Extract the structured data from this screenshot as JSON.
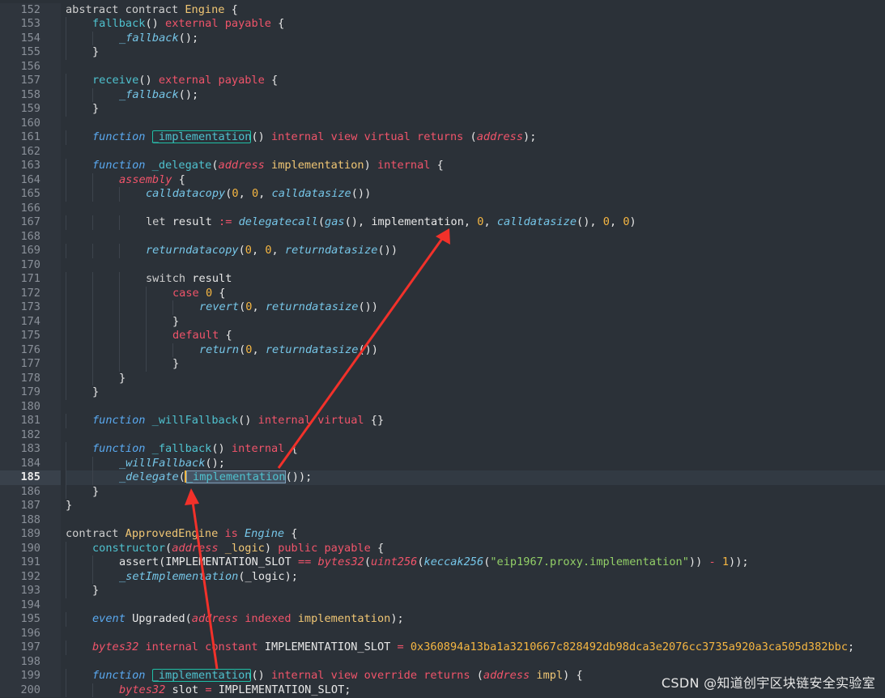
{
  "editor": {
    "current_line": 185,
    "lines": [
      {
        "n": "152",
        "indent": 0,
        "tokens": [
          [
            "abstract contract ",
            "kw"
          ],
          [
            "Engine",
            "ty"
          ],
          [
            " {",
            "pl"
          ]
        ]
      },
      {
        "n": "153",
        "indent": 1,
        "tokens": [
          [
            "fallback",
            "fn"
          ],
          [
            "() ",
            "pl"
          ],
          [
            "external payable",
            "mod"
          ],
          [
            " {",
            "pl"
          ]
        ]
      },
      {
        "n": "154",
        "indent": 2,
        "tokens": [
          [
            "_fallback",
            "iti"
          ],
          [
            "();",
            "pl"
          ]
        ]
      },
      {
        "n": "155",
        "indent": 1,
        "tokens": [
          [
            "}",
            "pl"
          ]
        ]
      },
      {
        "n": "156",
        "indent": 0,
        "tokens": []
      },
      {
        "n": "157",
        "indent": 1,
        "tokens": [
          [
            "receive",
            "fn"
          ],
          [
            "() ",
            "pl"
          ],
          [
            "external payable",
            "mod"
          ],
          [
            " {",
            "pl"
          ]
        ]
      },
      {
        "n": "158",
        "indent": 2,
        "tokens": [
          [
            "_fallback",
            "iti"
          ],
          [
            "();",
            "pl"
          ]
        ]
      },
      {
        "n": "159",
        "indent": 1,
        "tokens": [
          [
            "}",
            "pl"
          ]
        ]
      },
      {
        "n": "160",
        "indent": 0,
        "tokens": []
      },
      {
        "n": "161",
        "indent": 1,
        "tokens": [
          [
            "function",
            "it"
          ],
          [
            " ",
            "pl"
          ],
          [
            "_implementation",
            "hl"
          ],
          [
            "() ",
            "pl"
          ],
          [
            "internal view virtual returns",
            "mod"
          ],
          [
            " (",
            "pl"
          ],
          [
            "address",
            "ity"
          ],
          [
            ");",
            "pl"
          ]
        ]
      },
      {
        "n": "162",
        "indent": 0,
        "tokens": []
      },
      {
        "n": "163",
        "indent": 1,
        "tokens": [
          [
            "function",
            "it"
          ],
          [
            " ",
            "pl"
          ],
          [
            "_delegate",
            "fn"
          ],
          [
            "(",
            "pl"
          ],
          [
            "address",
            "ity"
          ],
          [
            " ",
            "pl"
          ],
          [
            "implementation",
            "ty"
          ],
          [
            ") ",
            "pl"
          ],
          [
            "internal",
            "mod"
          ],
          [
            " {",
            "pl"
          ]
        ]
      },
      {
        "n": "164",
        "indent": 2,
        "tokens": [
          [
            "assembly",
            "ity"
          ],
          [
            " {",
            "pl"
          ]
        ]
      },
      {
        "n": "165",
        "indent": 3,
        "tokens": [
          [
            "calldatacopy",
            "iti"
          ],
          [
            "(",
            "pl"
          ],
          [
            "0",
            "num"
          ],
          [
            ", ",
            "pl"
          ],
          [
            "0",
            "num"
          ],
          [
            ", ",
            "pl"
          ],
          [
            "calldatasize",
            "iti"
          ],
          [
            "())",
            "pl"
          ]
        ]
      },
      {
        "n": "166",
        "indent": 0,
        "tokens": []
      },
      {
        "n": "167",
        "indent": 3,
        "tokens": [
          [
            "let",
            "kw"
          ],
          [
            " result ",
            "pl"
          ],
          [
            ":=",
            "op"
          ],
          [
            " ",
            "pl"
          ],
          [
            "delegatecall",
            "iti"
          ],
          [
            "(",
            "pl"
          ],
          [
            "gas",
            "iti"
          ],
          [
            "(), implementation, ",
            "pl"
          ],
          [
            "0",
            "num"
          ],
          [
            ", ",
            "pl"
          ],
          [
            "calldatasize",
            "iti"
          ],
          [
            "(), ",
            "pl"
          ],
          [
            "0",
            "num"
          ],
          [
            ", ",
            "pl"
          ],
          [
            "0",
            "num"
          ],
          [
            ")",
            "pl"
          ]
        ]
      },
      {
        "n": "168",
        "indent": 0,
        "tokens": []
      },
      {
        "n": "169",
        "indent": 3,
        "tokens": [
          [
            "returndatacopy",
            "iti"
          ],
          [
            "(",
            "pl"
          ],
          [
            "0",
            "num"
          ],
          [
            ", ",
            "pl"
          ],
          [
            "0",
            "num"
          ],
          [
            ", ",
            "pl"
          ],
          [
            "returndatasize",
            "iti"
          ],
          [
            "())",
            "pl"
          ]
        ]
      },
      {
        "n": "170",
        "indent": 0,
        "tokens": []
      },
      {
        "n": "171",
        "indent": 3,
        "tokens": [
          [
            "switch",
            "kw"
          ],
          [
            " result",
            "pl"
          ]
        ]
      },
      {
        "n": "172",
        "indent": 4,
        "tokens": [
          [
            "case",
            "mod"
          ],
          [
            " ",
            "pl"
          ],
          [
            "0",
            "num"
          ],
          [
            " {",
            "pl"
          ]
        ]
      },
      {
        "n": "173",
        "indent": 5,
        "tokens": [
          [
            "revert",
            "iti"
          ],
          [
            "(",
            "pl"
          ],
          [
            "0",
            "num"
          ],
          [
            ", ",
            "pl"
          ],
          [
            "returndatasize",
            "iti"
          ],
          [
            "())",
            "pl"
          ]
        ]
      },
      {
        "n": "174",
        "indent": 4,
        "tokens": [
          [
            "}",
            "pl"
          ]
        ]
      },
      {
        "n": "175",
        "indent": 4,
        "tokens": [
          [
            "default",
            "mod"
          ],
          [
            " {",
            "pl"
          ]
        ]
      },
      {
        "n": "176",
        "indent": 5,
        "tokens": [
          [
            "return",
            "iti"
          ],
          [
            "(",
            "pl"
          ],
          [
            "0",
            "num"
          ],
          [
            ", ",
            "pl"
          ],
          [
            "returndatasize",
            "iti"
          ],
          [
            "())",
            "pl"
          ]
        ]
      },
      {
        "n": "177",
        "indent": 4,
        "tokens": [
          [
            "}",
            "pl"
          ]
        ]
      },
      {
        "n": "178",
        "indent": 2,
        "tokens": [
          [
            "}",
            "pl"
          ]
        ]
      },
      {
        "n": "179",
        "indent": 1,
        "tokens": [
          [
            "}",
            "pl"
          ]
        ]
      },
      {
        "n": "180",
        "indent": 0,
        "tokens": []
      },
      {
        "n": "181",
        "indent": 1,
        "tokens": [
          [
            "function",
            "it"
          ],
          [
            " ",
            "pl"
          ],
          [
            "_willFallback",
            "fn"
          ],
          [
            "() ",
            "pl"
          ],
          [
            "internal virtual",
            "mod"
          ],
          [
            " {}",
            "pl"
          ]
        ]
      },
      {
        "n": "182",
        "indent": 0,
        "tokens": []
      },
      {
        "n": "183",
        "indent": 1,
        "tokens": [
          [
            "function",
            "it"
          ],
          [
            " ",
            "pl"
          ],
          [
            "_fallback",
            "fn"
          ],
          [
            "() ",
            "pl"
          ],
          [
            "internal",
            "mod"
          ],
          [
            " {",
            "pl"
          ]
        ]
      },
      {
        "n": "184",
        "indent": 2,
        "tokens": [
          [
            "_willFallback",
            "iti"
          ],
          [
            "();",
            "pl"
          ]
        ]
      },
      {
        "n": "185",
        "indent": 2,
        "tokens": [
          [
            "_delegate",
            "iti"
          ],
          [
            "(",
            "pl"
          ],
          [
            "",
            "caret"
          ],
          [
            "_implementation",
            "hl2"
          ],
          [
            "());",
            "pl"
          ]
        ]
      },
      {
        "n": "186",
        "indent": 1,
        "tokens": [
          [
            "}",
            "pl"
          ]
        ]
      },
      {
        "n": "187",
        "indent": 0,
        "tokens": [
          [
            "}",
            "pl"
          ]
        ]
      },
      {
        "n": "188",
        "indent": 0,
        "tokens": []
      },
      {
        "n": "189",
        "indent": 0,
        "tokens": [
          [
            "contract ",
            "kw"
          ],
          [
            "ApprovedEngine",
            "ty"
          ],
          [
            " ",
            "pl"
          ],
          [
            "is",
            "mod"
          ],
          [
            " ",
            "pl"
          ],
          [
            "Engine",
            "iti"
          ],
          [
            " {",
            "pl"
          ]
        ]
      },
      {
        "n": "190",
        "indent": 1,
        "tokens": [
          [
            "constructor",
            "fn"
          ],
          [
            "(",
            "pl"
          ],
          [
            "address",
            "ity"
          ],
          [
            " ",
            "pl"
          ],
          [
            "_logic",
            "ty"
          ],
          [
            ") ",
            "pl"
          ],
          [
            "public payable",
            "mod"
          ],
          [
            " {",
            "pl"
          ]
        ]
      },
      {
        "n": "191",
        "indent": 2,
        "tokens": [
          [
            "assert(IMPLEMENTATION_SLOT ",
            "pl"
          ],
          [
            "==",
            "op"
          ],
          [
            " ",
            "pl"
          ],
          [
            "bytes32",
            "ity"
          ],
          [
            "(",
            "pl"
          ],
          [
            "uint256",
            "ity"
          ],
          [
            "(",
            "pl"
          ],
          [
            "keccak256",
            "iti"
          ],
          [
            "(",
            "pl"
          ],
          [
            "\"eip1967.proxy.implementation\"",
            "str"
          ],
          [
            ")) ",
            "pl"
          ],
          [
            "-",
            "op"
          ],
          [
            " ",
            "pl"
          ],
          [
            "1",
            "num"
          ],
          [
            "));",
            "pl"
          ]
        ]
      },
      {
        "n": "192",
        "indent": 2,
        "tokens": [
          [
            "_setImplementation",
            "iti"
          ],
          [
            "(_logic);",
            "pl"
          ]
        ]
      },
      {
        "n": "193",
        "indent": 1,
        "tokens": [
          [
            "}",
            "pl"
          ]
        ]
      },
      {
        "n": "194",
        "indent": 0,
        "tokens": []
      },
      {
        "n": "195",
        "indent": 1,
        "tokens": [
          [
            "event",
            "it"
          ],
          [
            " Upgraded(",
            "pl"
          ],
          [
            "address",
            "ity"
          ],
          [
            " ",
            "pl"
          ],
          [
            "indexed",
            "mod"
          ],
          [
            " ",
            "pl"
          ],
          [
            "implementation",
            "ty"
          ],
          [
            ");",
            "pl"
          ]
        ]
      },
      {
        "n": "196",
        "indent": 0,
        "tokens": []
      },
      {
        "n": "197",
        "indent": 1,
        "tokens": [
          [
            "bytes32",
            "ity"
          ],
          [
            " ",
            "pl"
          ],
          [
            "internal constant",
            "mod"
          ],
          [
            " IMPLEMENTATION_SLOT ",
            "pl"
          ],
          [
            "=",
            "op"
          ],
          [
            " ",
            "pl"
          ],
          [
            "0x360894a13ba1a3210667c828492db98dca3e2076cc3735a920a3ca505d382bbc",
            "num"
          ],
          [
            ";",
            "pl"
          ]
        ]
      },
      {
        "n": "198",
        "indent": 0,
        "tokens": []
      },
      {
        "n": "199",
        "indent": 1,
        "tokens": [
          [
            "function",
            "it"
          ],
          [
            " ",
            "pl"
          ],
          [
            "_implementation",
            "hl"
          ],
          [
            "() ",
            "pl"
          ],
          [
            "internal view override returns",
            "mod"
          ],
          [
            " (",
            "pl"
          ],
          [
            "address",
            "ity"
          ],
          [
            " ",
            "pl"
          ],
          [
            "impl",
            "ty"
          ],
          [
            ") {",
            "pl"
          ]
        ]
      },
      {
        "n": "200",
        "indent": 2,
        "tokens": [
          [
            "bytes32",
            "ity"
          ],
          [
            " slot ",
            "pl"
          ],
          [
            "=",
            "op"
          ],
          [
            " IMPLEMENTATION_SLOT;",
            "pl"
          ]
        ]
      }
    ]
  },
  "annotation": {
    "arrow_color": "#f2312a"
  },
  "watermark": {
    "text": "CSDN @知道创宇区块链安全实验室"
  }
}
